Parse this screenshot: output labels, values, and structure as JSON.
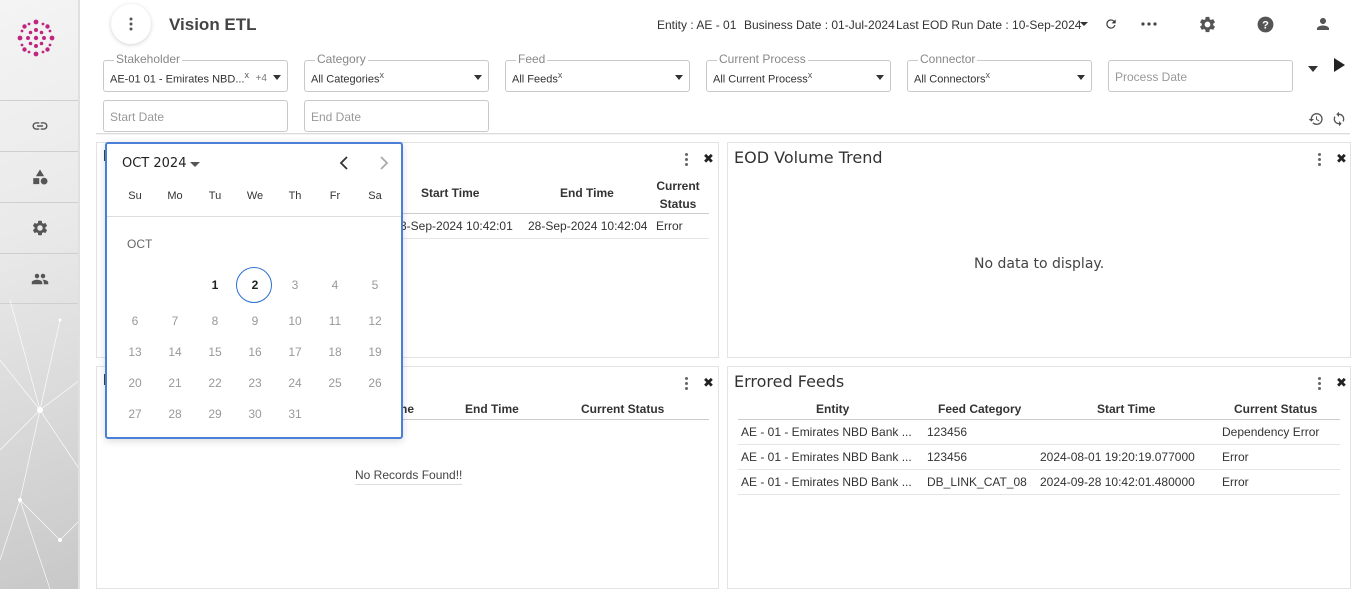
{
  "app": {
    "title": "Vision ETL"
  },
  "header": {
    "entity": "Entity : AE - 01",
    "business_date": "Business Date : 01-Jul-2024",
    "last_eod": "Last EOD Run Date : 10-Sep-2024"
  },
  "filters": {
    "stakeholder": {
      "label": "Stakeholder",
      "value": "AE-01 01 - Emirates NBD...",
      "clear": "x",
      "extra": "+4"
    },
    "category": {
      "label": "Category",
      "value": "All Categories",
      "clear": "x"
    },
    "feed": {
      "label": "Feed",
      "value": "All Feeds",
      "clear": "x"
    },
    "current_process": {
      "label": "Current Process",
      "value": "All Current Process",
      "clear": "x"
    },
    "connector": {
      "label": "Connector",
      "value": "All Connectors",
      "clear": "x"
    },
    "process_date": {
      "placeholder": "Process Date"
    },
    "start_date": {
      "placeholder": "Start Date"
    },
    "end_date": {
      "placeholder": "End Date"
    }
  },
  "panel_top_left": {
    "title_partial": "I",
    "columns": [
      "Start Time",
      "End Time",
      "Current Status"
    ],
    "current_status_line1": "Current",
    "current_status_line2": "Status",
    "rows": [
      {
        "start": "3-Sep-2024 10:42:01",
        "end": "28-Sep-2024 10:42:04",
        "status": "Error"
      }
    ]
  },
  "panel_eod": {
    "title": "EOD Volume Trend",
    "empty": "No data to display."
  },
  "panel_bottom_left": {
    "title_partial": "I",
    "columns": [
      "ne",
      "End Time",
      "Current Status"
    ],
    "empty": "No Records Found!!"
  },
  "panel_errored": {
    "title": "Errored Feeds",
    "columns": [
      "Entity",
      "Feed Category",
      "Start Time",
      "Current Status"
    ],
    "rows": [
      {
        "entity": "AE - 01 - Emirates NBD Bank ...",
        "category": "123456",
        "start": "",
        "status": "Dependency Error"
      },
      {
        "entity": "AE - 01 - Emirates NBD Bank ...",
        "category": "123456",
        "start": "2024-08-01 19:20:19.077000",
        "status": "Error"
      },
      {
        "entity": "AE - 01 - Emirates NBD Bank ...",
        "category": "DB_LINK_CAT_08",
        "start": "2024-09-28 10:42:01.480000",
        "status": "Error"
      }
    ]
  },
  "calendar": {
    "month_label": "OCT 2024",
    "section_label": "OCT",
    "weekdays": [
      "Su",
      "Mo",
      "Tu",
      "We",
      "Th",
      "Fr",
      "Sa"
    ],
    "selected_day": "2",
    "weeks": [
      [
        "",
        "",
        "1",
        "2",
        "3",
        "4",
        "5"
      ],
      [
        "6",
        "7",
        "8",
        "9",
        "10",
        "11",
        "12"
      ],
      [
        "13",
        "14",
        "15",
        "16",
        "17",
        "18",
        "19"
      ],
      [
        "20",
        "21",
        "22",
        "23",
        "24",
        "25",
        "26"
      ],
      [
        "27",
        "28",
        "29",
        "30",
        "31",
        "",
        ""
      ]
    ],
    "enabled_days": [
      "1",
      "2"
    ]
  },
  "colors": {
    "accent": "#2b6fd0",
    "logo": "#c0267f"
  },
  "icons": {
    "sidebar": [
      "link-icon",
      "shapes-icon",
      "gear-icon",
      "users-icon"
    ],
    "header": [
      "refresh-icon",
      "more-horizontal-icon",
      "settings-icon",
      "help-icon",
      "user-icon"
    ]
  }
}
